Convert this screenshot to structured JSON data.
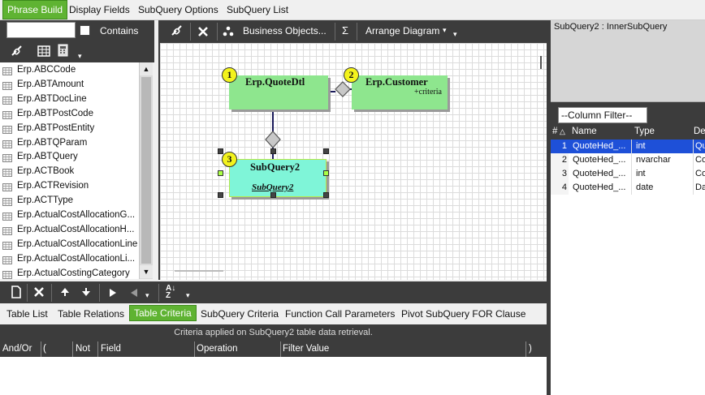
{
  "top_tabs": [
    {
      "label": "Phrase Build",
      "active": true
    },
    {
      "label": "Display Fields",
      "active": false
    },
    {
      "label": "SubQuery Options",
      "active": false
    },
    {
      "label": "SubQuery List",
      "active": false
    }
  ],
  "left": {
    "filter_value": "",
    "contains_label": "Contains",
    "tables": [
      "Erp.ABCCode",
      "Erp.ABTAmount",
      "Erp.ABTDocLine",
      "Erp.ABTPostCode",
      "Erp.ABTPostEntity",
      "Erp.ABTQParam",
      "Erp.ABTQuery",
      "Erp.ACTBook",
      "Erp.ACTRevision",
      "Erp.ACTType",
      "Erp.ActualCostAllocationG...",
      "Erp.ActualCostAllocationH...",
      "Erp.ActualCostAllocationLine",
      "Erp.ActualCostAllocationLi...",
      "Erp.ActualCostingCategory"
    ]
  },
  "diagram_toolbar": {
    "business_objects": "Business Objects...",
    "sigma": "Σ",
    "arrange": "Arrange Diagram"
  },
  "diagram": {
    "t1": {
      "num": "1",
      "name": "Erp.QuoteDtl"
    },
    "t2": {
      "num": "2",
      "name": "Erp.Customer",
      "note": "+criteria"
    },
    "t3": {
      "num": "3",
      "name": "SubQuery2",
      "link": "SubQuery2"
    }
  },
  "right": {
    "title": "SubQuery2 : InnerSubQuery",
    "column_filter": "--Column Filter--",
    "headers": {
      "num": "#",
      "name": "Name",
      "type": "Type",
      "desc": "De"
    },
    "rows": [
      {
        "n": "1",
        "name": "QuoteHed_...",
        "type": "int",
        "desc": "Qu",
        "selected": true
      },
      {
        "n": "2",
        "name": "QuoteHed_...",
        "type": "nvarchar",
        "desc": "Co",
        "selected": false
      },
      {
        "n": "3",
        "name": "QuoteHed_...",
        "type": "int",
        "desc": "Co",
        "selected": false
      },
      {
        "n": "4",
        "name": "QuoteHed_...",
        "type": "date",
        "desc": "Da",
        "selected": false
      }
    ]
  },
  "bottom_tabs": [
    {
      "label": "Table List",
      "active": false
    },
    {
      "label": "Table Relations",
      "active": false
    },
    {
      "label": "Table Criteria",
      "active": true
    },
    {
      "label": "SubQuery Criteria",
      "active": false
    },
    {
      "label": "Function Call Parameters",
      "active": false
    },
    {
      "label": "Pivot SubQuery FOR Clause",
      "active": false
    }
  ],
  "criteria": {
    "banner": "Criteria applied on SubQuery2 table data retrieval.",
    "columns": {
      "andor": "And/Or",
      "lparen": "(",
      "not": "Not",
      "field": "Field",
      "operation": "Operation",
      "filter_value": "Filter Value",
      "rparen": ")"
    }
  },
  "colors": {
    "accent_green": "#5fb332",
    "dark_panel": "#3c3c3c",
    "table_green": "#8ee68e",
    "subquery_cyan": "#7ff5d8",
    "badge_yellow": "#f3f31c",
    "selection_blue": "#1e50d8"
  }
}
